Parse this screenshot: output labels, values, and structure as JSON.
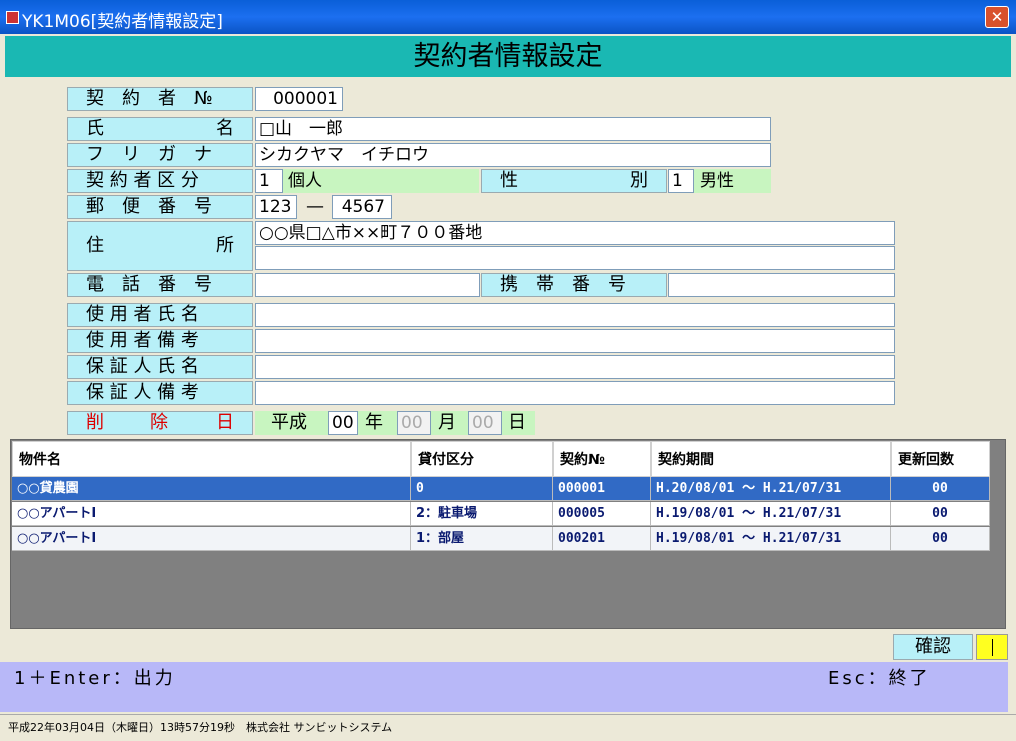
{
  "window": {
    "title": "YK1M06[契約者情報設定]",
    "close_glyph": "✕"
  },
  "header": {
    "title": "契約者情報設定"
  },
  "labels": {
    "contractor_no": "契　約　者　№",
    "name": [
      "氏",
      "名"
    ],
    "furigana": "フ　リ　ガ　ナ",
    "contractor_type": "契 約 者 区 分",
    "gender": [
      "性",
      "別"
    ],
    "postal": "郵　便　番　号",
    "address": [
      "住",
      "所"
    ],
    "phone": "電　話　番　号",
    "mobile": "携　帯　番　号",
    "user_name": "使 用 者 氏 名",
    "user_note": "使 用 者 備 考",
    "guarantor_name": "保 証 人 氏 名",
    "guarantor_note": "保 証 人 備 考",
    "delete_date": [
      "削",
      "除",
      "日"
    ]
  },
  "fields": {
    "contractor_no": "000001",
    "name": "□山　一郎",
    "furigana": "シカクヤマ　イチロウ",
    "contractor_type_code": "1",
    "contractor_type_name": "個人",
    "gender_code": "1",
    "gender_name": "男性",
    "postal_1": "123",
    "postal_dash": "—",
    "postal_2": "4567",
    "address_1": "○○県□△市××町７００番地",
    "address_2": "",
    "phone": "",
    "mobile": "",
    "user_name": "",
    "user_note": "",
    "guarantor_name": "",
    "guarantor_note": "",
    "era": "平成",
    "year": "00",
    "year_unit": "年",
    "month": "00",
    "month_unit": "月",
    "day": "00",
    "day_unit": "日"
  },
  "grid": {
    "columns": [
      "物件名",
      "貸付区分",
      "契約№",
      "契約期間",
      "更新回数"
    ],
    "rows": [
      [
        "○○貸農園",
        "0",
        "000001",
        "H.20/08/01 ～ H.21/07/31",
        "00"
      ],
      [
        "○○アパートⅠ",
        "2：駐車場",
        "000005",
        "H.19/08/01 ～ H.21/07/31",
        "00"
      ],
      [
        "○○アパートⅠ",
        "1：部屋",
        "000201",
        "H.19/08/01 ～ H.21/07/31",
        "00"
      ]
    ]
  },
  "confirm": {
    "label": "確認",
    "value": ""
  },
  "function_keys": {
    "left": "1＋Enter：出力",
    "right": "Esc：終了"
  },
  "status": {
    "text": "平成22年03月04日（木曜日）13時57分19秒　株式会社 サンビットシステム"
  }
}
